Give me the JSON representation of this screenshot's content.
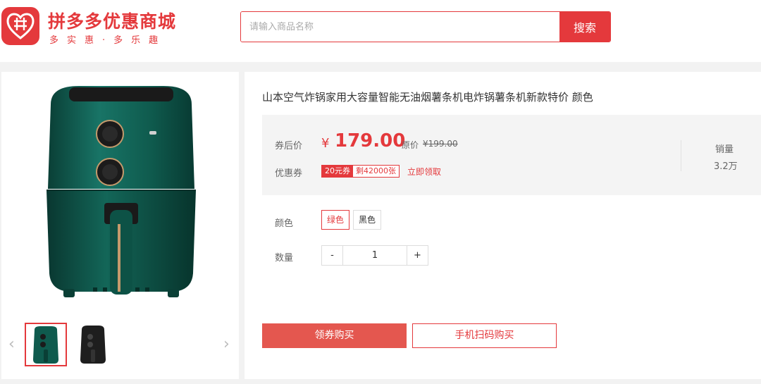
{
  "header": {
    "brand_name": "拼多多优惠商城",
    "slogan": "多实惠·多乐趣",
    "logo_icon": "pinduoduo-logo-icon",
    "search": {
      "placeholder": "请输入商品名称",
      "value": "",
      "button_label": "搜索"
    }
  },
  "gallery": {
    "main_image": "green-air-fryer",
    "thumbnails": [
      "green-air-fryer",
      "black-air-fryer"
    ],
    "selected_index": 0,
    "prev_icon": "chevron-left-icon",
    "next_icon": "chevron-right-icon"
  },
  "product": {
    "title": "山本空气炸锅家用大容量智能无油烟薯条机电炸锅薯条机新款特价 颜色",
    "price_label": "券后价",
    "currency": "¥",
    "price": "179.00",
    "original_label": "原价",
    "original_price": "¥199.00",
    "coupon_label": "优惠券",
    "coupon_value": "20元券",
    "coupon_remaining": "剩42000张",
    "coupon_claim": "立即领取",
    "sales_label": "销量",
    "sales_value": "3.2万",
    "color_label": "颜色",
    "colors": [
      "绿色",
      "黑色"
    ],
    "selected_color": "绿色",
    "quantity_label": "数量",
    "quantity": "1",
    "minus": "-",
    "plus": "+",
    "buy_button": "领券购买",
    "scan_button": "手机扫码购买"
  },
  "colors": {
    "accent": "#e4393c",
    "buy_button": "#e4574f",
    "product_green": "#0f5b4e"
  }
}
